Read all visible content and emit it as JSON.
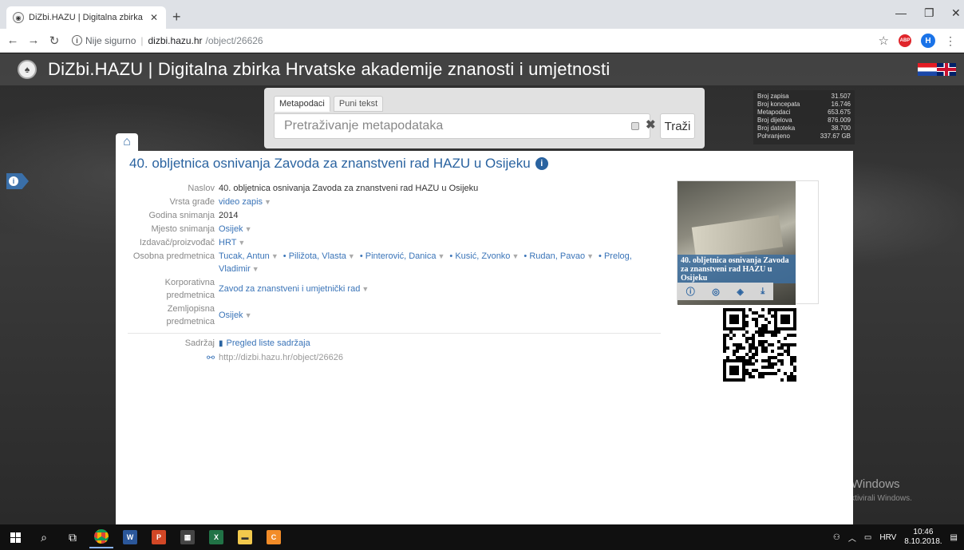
{
  "browser": {
    "tab_title": "DiZbi.HAZU | Digitalna zbirka Hrv",
    "new_tab": "+",
    "address_secure": "Nije sigurno",
    "address_host": "dizbi.hazu.hr",
    "address_path": "/object/26626",
    "profile_initial": "H",
    "adblock": "ABP"
  },
  "site": {
    "title": "DiZbi.HAZU | Digitalna zbirka Hrvatske akademije znanosti i umjetnosti"
  },
  "search": {
    "tab_metadata": "Metapodaci",
    "tab_fulltext": "Puni tekst",
    "placeholder": "Pretraživanje metapodataka",
    "button": "Traži"
  },
  "stats": [
    {
      "label": "Broj zapisa",
      "value": "31.507"
    },
    {
      "label": "Broj koncepata",
      "value": "16.746"
    },
    {
      "label": "Metapodaci",
      "value": "653.675"
    },
    {
      "label": "Broj dijelova",
      "value": "876.009"
    },
    {
      "label": "Broj datoteka",
      "value": "38.700"
    },
    {
      "label": "Pohranjeno",
      "value": "337.67 GB"
    }
  ],
  "object": {
    "title": "40. obljetnica osnivanja Zavoda za znanstveni rad HAZU u Osijeku",
    "fields": {
      "naslov_label": "Naslov",
      "naslov": "40. obljetnica osnivanja Zavoda za znanstveni rad HAZU u Osijeku",
      "vrsta_label": "Vrsta građe",
      "vrsta": "video zapis",
      "godina_label": "Godina snimanja",
      "godina": "2014",
      "mjesto_label": "Mjesto snimanja",
      "mjesto": "Osijek",
      "izdavac_label": "Izdavač/proizvođač",
      "izdavac": "HRT",
      "osobna_label": "Osobna predmetnica",
      "osobe": [
        "Tucak, Antun",
        "Piližota, Vlasta",
        "Pinterović, Danica",
        "Kusić, Zvonko",
        "Rudan, Pavao",
        "Prelog, Vladimir"
      ],
      "korp_label_1": "Korporativna",
      "korp_label_2": "predmetnica",
      "korporativna": "Zavod za znanstveni i umjetnički rad",
      "zemlj_label_1": "Zemljopisna",
      "zemlj_label_2": "predmetnica",
      "zemljopisna": "Osijek",
      "sadrzaj_label": "Sadržaj",
      "sadrzaj_link": "Pregled liste sadržaja",
      "permalink": "http://dizbi.hazu.hr/object/26626"
    },
    "thumbnail_caption": "40. obljetnica osnivanja Zavoda za znanstveni rad HAZU u Osijeku"
  },
  "watermark": {
    "line1": "Aktivirajte sustav Windows",
    "line2": "Idite u postavke da biste aktivirali Windows."
  },
  "taskbar": {
    "lang": "HRV",
    "time": "10:46",
    "date": "8.10.2018."
  }
}
